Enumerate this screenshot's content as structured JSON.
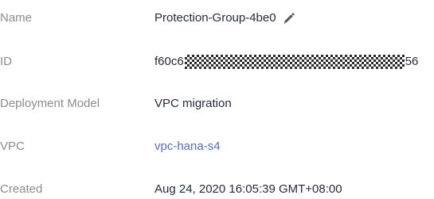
{
  "details": {
    "name": {
      "label": "Name",
      "value": "Protection-Group-4be0",
      "edit_icon": "pencil-icon"
    },
    "id": {
      "label": "ID",
      "value_prefix": "f60c6",
      "value_suffix": "56"
    },
    "deployment_model": {
      "label": "Deployment Model",
      "value": "VPC migration"
    },
    "vpc": {
      "label": "VPC",
      "value": "vpc-hana-s4"
    },
    "created": {
      "label": "Created",
      "value": "Aug 24, 2020 16:05:39 GMT+08:00"
    }
  },
  "colors": {
    "label": "#8c8c8c",
    "value": "#252b3a",
    "link": "#526ecc"
  }
}
